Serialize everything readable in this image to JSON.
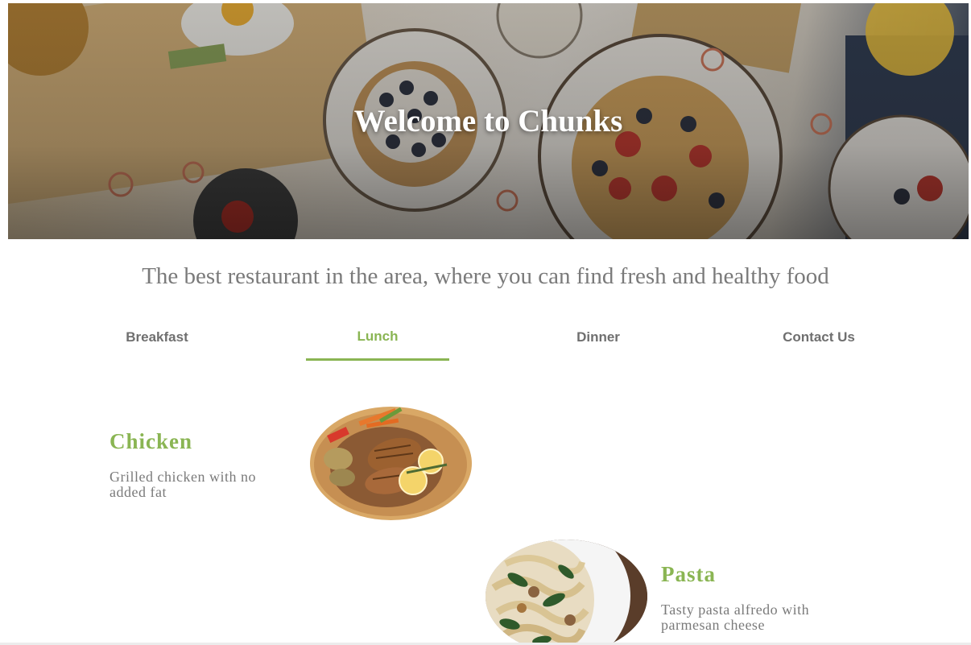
{
  "hero": {
    "title": "Welcome to Chunks"
  },
  "tagline": "The best restaurant in the area, where you can find fresh and healthy food",
  "tabs": [
    {
      "label": "Breakfast",
      "active": false
    },
    {
      "label": "Lunch",
      "active": true
    },
    {
      "label": "Dinner",
      "active": false
    },
    {
      "label": "Contact Us",
      "active": false
    }
  ],
  "menu": {
    "items": [
      {
        "name": "Chicken",
        "description": "Grilled chicken with no added fat",
        "image": "grilled-chicken-plate-image"
      },
      {
        "name": "Pasta",
        "description": "Tasty pasta alfredo with parmesan cheese",
        "image": "pasta-alfredo-plate-image"
      }
    ]
  },
  "colors": {
    "accent": "#8ab553",
    "text_muted": "#7a7a7a",
    "tab_text": "#6f6f6f"
  }
}
